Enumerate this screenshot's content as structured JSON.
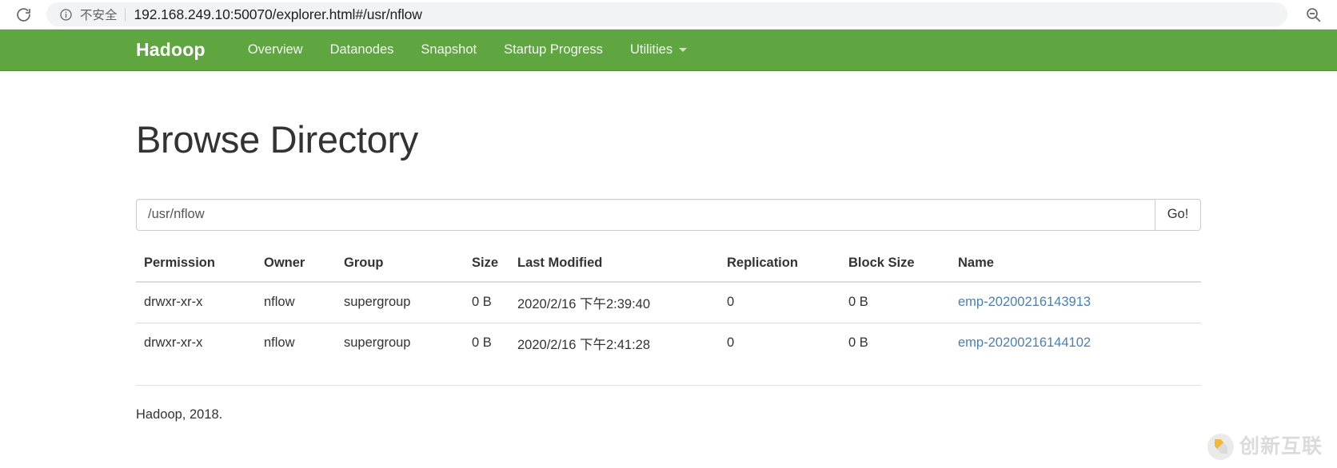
{
  "browser": {
    "reload_icon": "reload-icon",
    "info_icon": "info-circle-icon",
    "security_label": "不安全",
    "url": "192.168.249.10:50070/explorer.html#/usr/nflow",
    "zoom_icon": "zoom-out-icon"
  },
  "navbar": {
    "brand": "Hadoop",
    "background": "#5fa641",
    "items": [
      {
        "label": "Overview",
        "dropdown": false
      },
      {
        "label": "Datanodes",
        "dropdown": false
      },
      {
        "label": "Snapshot",
        "dropdown": false
      },
      {
        "label": "Startup Progress",
        "dropdown": false
      },
      {
        "label": "Utilities",
        "dropdown": true
      }
    ]
  },
  "page": {
    "title": "Browse Directory"
  },
  "path_form": {
    "value": "/usr/nflow",
    "placeholder": "",
    "go_label": "Go!"
  },
  "table": {
    "headers": [
      "Permission",
      "Owner",
      "Group",
      "Size",
      "Last Modified",
      "Replication",
      "Block Size",
      "Name"
    ],
    "rows": [
      {
        "permission": "drwxr-xr-x",
        "owner": "nflow",
        "group": "supergroup",
        "size": "0 B",
        "last_modified": "2020/2/16 下午2:39:40",
        "replication": "0",
        "block_size": "0 B",
        "name": "emp-20200216143913"
      },
      {
        "permission": "drwxr-xr-x",
        "owner": "nflow",
        "group": "supergroup",
        "size": "0 B",
        "last_modified": "2020/2/16 下午2:41:28",
        "replication": "0",
        "block_size": "0 B",
        "name": "emp-20200216144102"
      }
    ]
  },
  "footer": {
    "text": "Hadoop, 2018."
  },
  "watermark": {
    "text": "创新互联"
  },
  "colors": {
    "brand_green": "#5fa641",
    "link_blue": "#4a7ebb"
  }
}
